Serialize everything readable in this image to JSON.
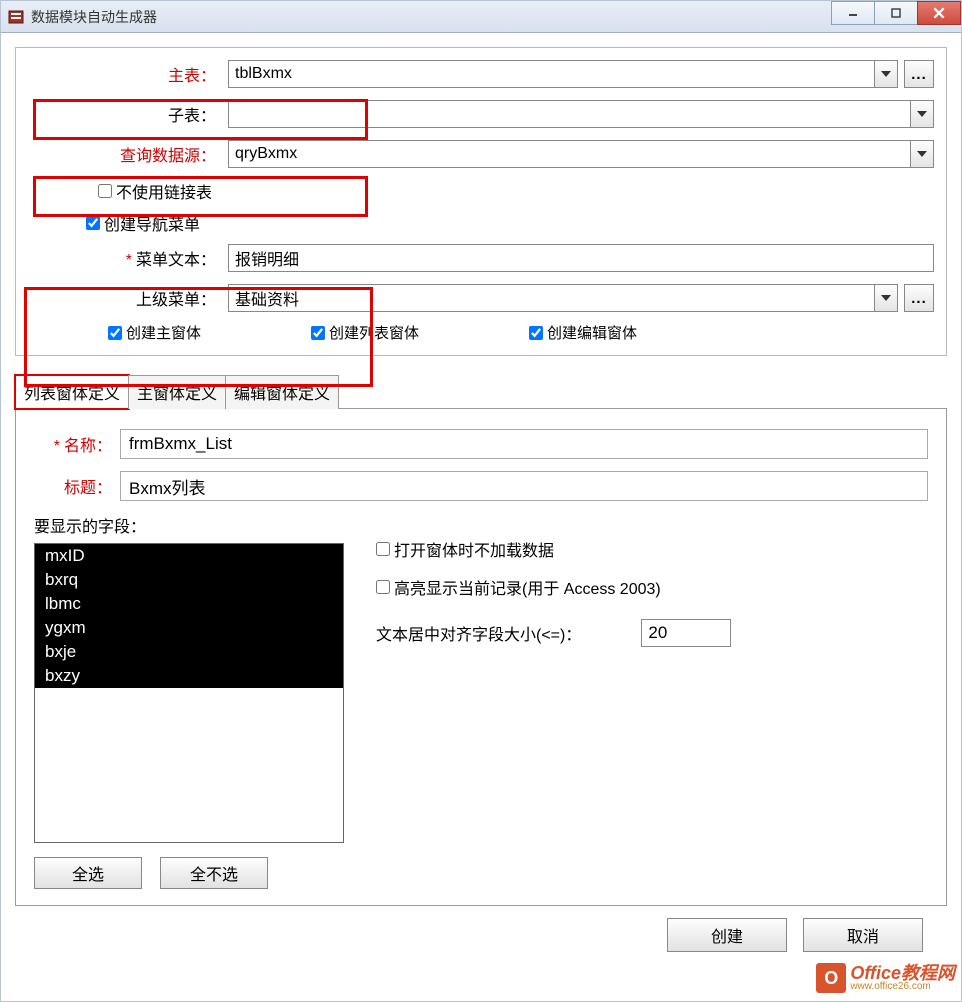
{
  "window": {
    "title": "数据模块自动生成器"
  },
  "form": {
    "main_table_label": "主表：",
    "main_table_value": "tblBxmx",
    "sub_table_label": "子表：",
    "sub_table_value": "",
    "query_label": "查询数据源：",
    "query_value": "qryBxmx",
    "no_link_table_label": "不使用链接表",
    "create_nav_label": "创建导航菜单",
    "menu_text_label": "菜单文本：",
    "menu_text_value": "报销明细",
    "parent_menu_label": "上级菜单：",
    "parent_menu_value": "基础资料",
    "create_main_form": "创建主窗体",
    "create_list_form": "创建列表窗体",
    "create_edit_form": "创建编辑窗体"
  },
  "tabs": {
    "list_def": "列表窗体定义",
    "main_def": "主窗体定义",
    "edit_def": "编辑窗体定义"
  },
  "list_tab": {
    "name_label": "名称：",
    "name_value": "frmBxmx_List",
    "title_label": "标题：",
    "title_value": "Bxmx列表",
    "fields_label": "要显示的字段：",
    "fields": [
      "mxID",
      "bxrq",
      "lbmc",
      "ygxm",
      "bxje",
      "bxzy"
    ],
    "select_all": "全选",
    "select_none": "全不选",
    "no_load_label": "打开窗体时不加载数据",
    "highlight_label": "高亮显示当前记录(用于 Access 2003)",
    "align_label": "文本居中对齐字段大小(<=)：",
    "align_value": "20"
  },
  "footer": {
    "create": "创建",
    "cancel": "取消"
  },
  "watermark": {
    "brand": "Office教程网",
    "url": "www.office26.com"
  }
}
